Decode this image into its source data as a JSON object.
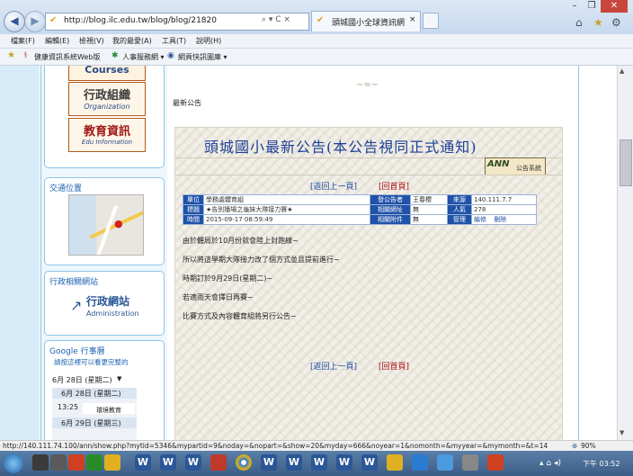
{
  "browser": {
    "url": "http://blog.ilc.edu.tw/blog/blog/21820",
    "tab_title": "頭城國小全球資訊網",
    "menu": [
      "檔案(F)",
      "編輯(E)",
      "檢視(V)",
      "我的最愛(A)",
      "工具(T)",
      "說明(H)"
    ],
    "favorites": [
      "健康資訊系統Web版",
      "人事服務網 ▾",
      "網頁快訊圖庫 ▾"
    ]
  },
  "sidebar": {
    "banner_courses": "Courses",
    "banner_admin_org": "行政組織",
    "banner_admin_org_en": "Organization",
    "banner_edu": "教育資訊",
    "banner_edu_en": "Edu Information",
    "traffic_title": "交通位置",
    "related_title": "行政相關網站",
    "admin_site": "行政網站",
    "admin_site_en": "Administration",
    "calendar_title": "Google 行事曆",
    "calendar_hint": "請按這裡可以看更完整的",
    "calendar_date": "6月 28日 (星期二)",
    "calendar_day1": "6月 28日 (星期二)",
    "calendar_time": "13:25",
    "calendar_event": "環境教育",
    "calendar_day2": "6月 29日 (星期三)"
  },
  "content": {
    "section_label": "最新公告",
    "announce_title": "頭城國小最新公告(本公告視同正式通知)",
    "system_badge": "公告系統",
    "back_prev": "[返回上一頁]",
    "home": "[回首頁]",
    "info": {
      "unit_label": "單位",
      "unit_value": "學務處體育組",
      "publisher_label": "發公告者",
      "publisher_value": "王春櫻",
      "source_label": "來源",
      "source_value": "140.111.7.7",
      "title_label": "標題",
      "title_value": "★告別播場之龜妹大隊接力賽★",
      "related_url_label": "相關網址",
      "related_url_value": "無",
      "views_label": "人氣",
      "views_value": "278",
      "time_label": "時間",
      "time_value": "2015-09-17 08:59:49",
      "attach_label": "相關附件",
      "attach_value": "無",
      "manage_label": "管理",
      "edit": "編修",
      "delete": "刪除"
    },
    "paragraphs": [
      "由於體局於10月份就會陸上封跑線~",
      "所以將這學期大隊接力改了個方式並且提前進行~",
      "時期訂於9月29日(星期二)~",
      "若適雨天會擇日再賽~",
      "比賽方式及內容體育組將另行公告~"
    ]
  },
  "status_bar": {
    "url": "http://140.111.74.100/ann/show.php?mytid=5346&mypartid=9&noday=&nopart=&show=20&myday=666&noyear=1&nomonth=&myyear=&mymonth=&t=14",
    "zoom": "90%"
  },
  "taskbar": {
    "clock": "下午 03:52"
  },
  "colors": {
    "accent_blue": "#1f52a8",
    "link_blue": "#1f4fa0",
    "link_red": "#b01010"
  }
}
